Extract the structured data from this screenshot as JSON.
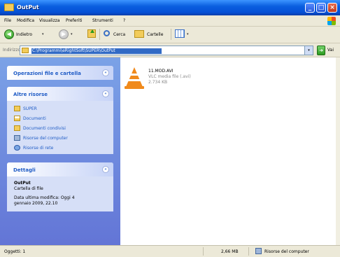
{
  "window": {
    "title": "OutPut",
    "minimize": "_",
    "maximize": "□",
    "close": "×"
  },
  "menu": [
    "File",
    "Modifica",
    "Visualizza",
    "Preferiti",
    "Strumenti",
    "?"
  ],
  "toolbar": {
    "back_label": "Indietro",
    "search_label": "Cerca",
    "folders_label": "Cartelle",
    "caret": "▾"
  },
  "address": {
    "label": "Indirizzo",
    "value": "C:\\Programmi\\eRightSoft\\SUPER\\OutPut",
    "go_label": "Vai",
    "dropdown": "▾"
  },
  "left_pane": {
    "tasks_box": {
      "title": "Operazioni file e cartella",
      "toggle": "«"
    },
    "other_box": {
      "title": "Altre risorse",
      "toggle": "«",
      "items": [
        "SUPER",
        "Documenti",
        "Documenti condivisi",
        "Risorse del computer",
        "Risorse di rete"
      ]
    },
    "details_box": {
      "title": "Dettagli",
      "toggle": "«",
      "name": "OutPut",
      "type": "Cartella di file",
      "modified_line1": "Data ultima modifica: Oggi 4",
      "modified_line2": "gennaio 2009, 22.10"
    }
  },
  "files": [
    {
      "name": "11.MOD.AVI",
      "type": "VLC media file (.avi)",
      "size": "2.734 KB",
      "icon": "vlc-cone-icon"
    }
  ],
  "status": {
    "objects": "Oggetti: 1",
    "size": "2,66 MB",
    "location": "Risorse del computer"
  }
}
